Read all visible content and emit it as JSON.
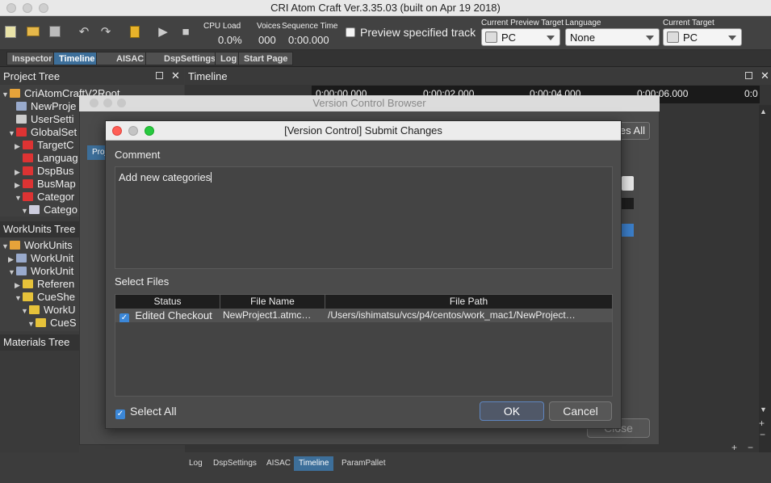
{
  "app": {
    "title": "CRI Atom Craft  Ver.3.35.03 (built on Apr 19 2018)"
  },
  "toolbar": {
    "cpu_label": "CPU Load",
    "cpu_value": "0.0%",
    "voices_label": "Voices",
    "voices_value": "000",
    "seq_label": "Sequence Time",
    "seq_value": "0:00.000",
    "preview_checkbox_label": "Preview specified track",
    "preview_target_label": "Current Preview Target",
    "preview_target_value": "PC",
    "language_label": "Language",
    "language_value": "None",
    "current_target_label": "Current Target",
    "current_target_value": "PC"
  },
  "tabs": [
    "Inspector",
    "Timeline",
    "AISAC",
    "DspSettings",
    "Log",
    "Start Page"
  ],
  "project_tree": {
    "title": "Project Tree",
    "items": [
      "CriAtomCraftV2Root",
      "NewProje",
      "UserSetti",
      "GlobalSet",
      "TargetC",
      "Languag",
      "DspBus",
      "BusMap",
      "Categor",
      "Catego"
    ]
  },
  "workunits_tree": {
    "title": "WorkUnits Tree",
    "items": [
      "WorkUnits",
      "WorkUnit",
      "WorkUnit",
      "Referen",
      "CueShe",
      "WorkU",
      "CueS"
    ]
  },
  "materials_tree": {
    "title": "Materials Tree"
  },
  "timeline": {
    "title": "Timeline",
    "ruler": [
      "0:00:00.000",
      "0:00:02.000",
      "0:00:04.000",
      "0:00:06.000",
      "0:0"
    ]
  },
  "version_control": {
    "title": "Version Control Browser",
    "partial_button": "es All",
    "close_button": "Close",
    "left_tab": "Proj"
  },
  "dialog": {
    "title": "[Version Control] Submit Changes",
    "comment_label": "Comment",
    "comment_text": "Add new categories",
    "select_files_label": "Select Files",
    "columns": [
      "Status",
      "File Name",
      "File Path"
    ],
    "rows": [
      {
        "status": "Edited Checkout",
        "file_name": "NewProject1.atmc…",
        "file_path": "/Users/ishimatsu/vcs/p4/centos/work_mac1/NewProject…",
        "checked": true
      }
    ],
    "select_all_label": "Select All",
    "ok_label": "OK",
    "cancel_label": "Cancel"
  },
  "bottom_tabs": [
    "Log",
    "DspSettings",
    "AISAC",
    "Timeline",
    "ParamPallet"
  ],
  "colors": {
    "accent": "#3d6f9a",
    "close_dot": "#ff5f56",
    "min_dot": "#7a7a7a",
    "max_dot": "#27c93f"
  }
}
